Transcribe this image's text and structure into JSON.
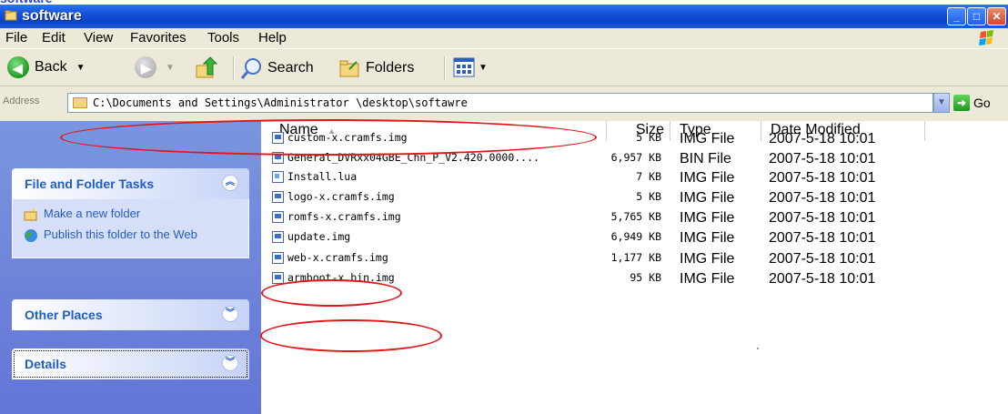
{
  "window": {
    "title": "software",
    "buttons": {
      "minimize": "_",
      "maximize": "□",
      "close": "✕"
    }
  },
  "menu": [
    "File",
    "Edit",
    "View",
    "Favorites",
    "Tools",
    "Help"
  ],
  "toolbar": {
    "back": "Back",
    "search": "Search",
    "folders": "Folders"
  },
  "address": {
    "label": "Address",
    "value": "C:\\Documents and Settings\\Administrator \\desktop\\softawre",
    "go": "Go"
  },
  "left_pane": {
    "file_tasks": {
      "title": "File and Folder Tasks",
      "items": [
        "Make a new folder",
        "Publish this folder to the Web"
      ]
    },
    "other_places": {
      "title": "Other Places"
    },
    "details": {
      "title": "Details"
    }
  },
  "columns": [
    "Name",
    "Size",
    "Type",
    "Date Modified"
  ],
  "files": [
    {
      "name": "custom-x.cramfs.img",
      "size": "5 KB",
      "type": "IMG File",
      "date": "2007-5-18 10:01",
      "icon": "img-file-icon"
    },
    {
      "name": "General_DVRxx04GBE_Chn_P_V2.420.0000....",
      "size": "6,957 KB",
      "type": "BIN File",
      "date": "2007-5-18 10:01",
      "icon": "img-file-icon"
    },
    {
      "name": "Install.lua",
      "size": "7 KB",
      "type": "IMG File",
      "date": "2007-5-18 10:01",
      "icon": "lua-file-icon"
    },
    {
      "name": "logo-x.cramfs.img",
      "size": "5 KB",
      "type": "IMG File",
      "date": "2007-5-18 10:01",
      "icon": "img-file-icon"
    },
    {
      "name": "romfs-x.cramfs.img",
      "size": "5,765 KB",
      "type": "IMG File",
      "date": "2007-5-18 10:01",
      "icon": "img-file-icon"
    },
    {
      "name": "update.img",
      "size": "6,949 KB",
      "type": "IMG File",
      "date": "2007-5-18 10:01",
      "icon": "img-file-icon"
    },
    {
      "name": "web-x.cramfs.img",
      "size": "1,177 KB",
      "type": "IMG File",
      "date": "2007-5-18 10:01",
      "icon": "img-file-icon"
    },
    {
      "name": "armboot-x.bin.img",
      "size": "95 KB",
      "type": "IMG File",
      "date": "2007-5-18 10:01",
      "icon": "img-file-icon"
    }
  ],
  "colors": {
    "titlebar": "#0a44c9",
    "task_pane": "#6375d6",
    "link": "#215dc6",
    "annotation": "#e3161a"
  }
}
